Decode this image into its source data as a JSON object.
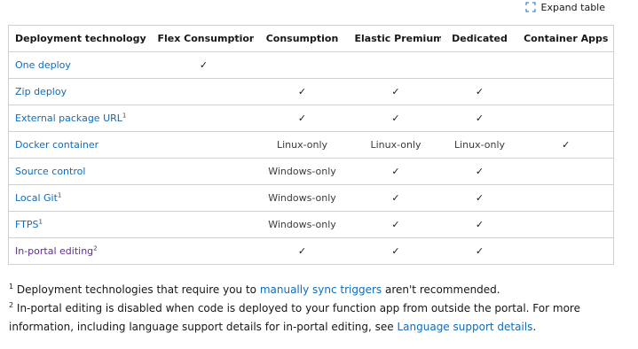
{
  "expand_table": {
    "label": "Expand table",
    "icon": "expand-icon"
  },
  "table": {
    "headers": [
      "Deployment technology",
      "Flex Consumption",
      "Consumption",
      "Elastic Premium",
      "Dedicated",
      "Container Apps"
    ],
    "rows": [
      {
        "name": "One deploy",
        "sup": "",
        "cells": [
          "✓",
          "",
          "",
          "",
          ""
        ]
      },
      {
        "name": "Zip deploy",
        "sup": "",
        "cells": [
          "",
          "✓",
          "✓",
          "✓",
          ""
        ]
      },
      {
        "name": "External package URL",
        "sup": "1",
        "cells": [
          "",
          "✓",
          "✓",
          "✓",
          ""
        ]
      },
      {
        "name": "Docker container",
        "sup": "",
        "cells": [
          "",
          "Linux-only",
          "Linux-only",
          "Linux-only",
          "✓"
        ]
      },
      {
        "name": "Source control",
        "sup": "",
        "cells": [
          "",
          "Windows-only",
          "✓",
          "✓",
          ""
        ]
      },
      {
        "name": "Local Git",
        "sup": "1",
        "cells": [
          "",
          "Windows-only",
          "✓",
          "✓",
          ""
        ]
      },
      {
        "name": "FTPS",
        "sup": "1",
        "cells": [
          "",
          "Windows-only",
          "✓",
          "✓",
          ""
        ]
      },
      {
        "name": "In-portal editing",
        "sup": "2",
        "cells": [
          "",
          "✓",
          "✓",
          "✓",
          ""
        ]
      }
    ]
  },
  "footnotes": {
    "note1": {
      "marker": "1",
      "before": " Deployment technologies that require you to ",
      "link": "manually sync triggers",
      "after": " aren't recommended."
    },
    "note2": {
      "marker": "2",
      "before": " In-portal editing is disabled when code is deployed to your function app from outside the portal. For more information, including language support details for in-portal editing, see ",
      "link": "Language support details",
      "after": "."
    }
  },
  "colors": {
    "link": "#0f6cbd",
    "visited_link": "#5c2e91",
    "border": "#d1d1d1",
    "text": "#171717"
  }
}
